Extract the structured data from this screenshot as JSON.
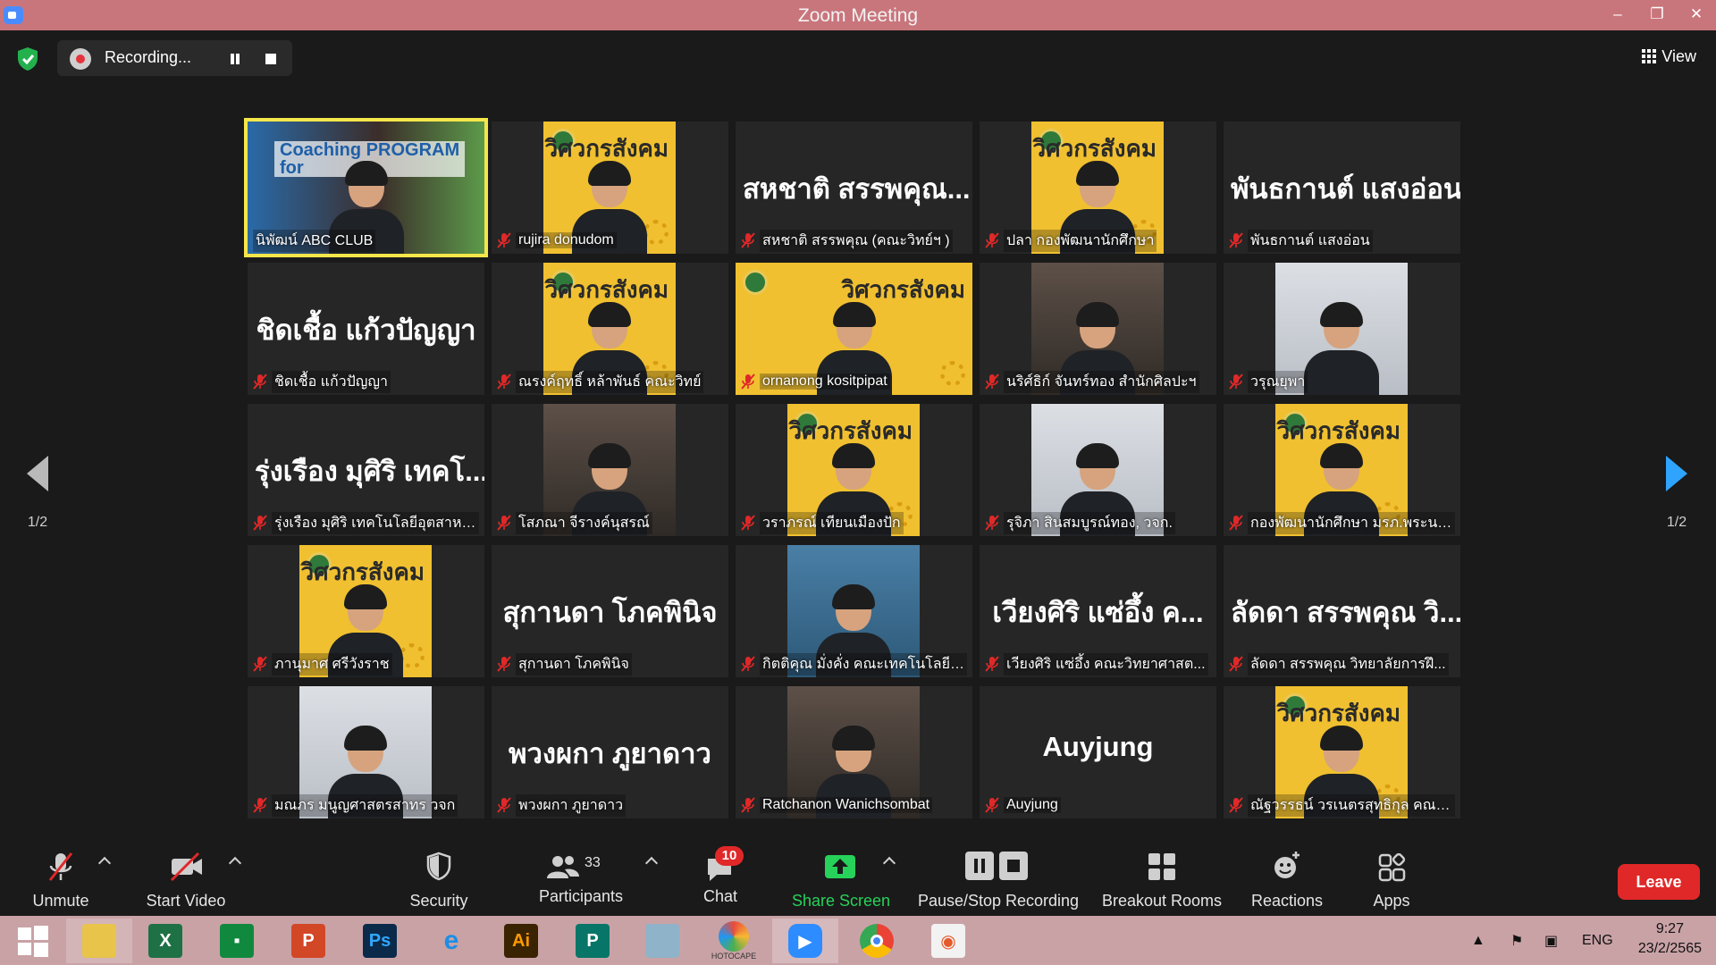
{
  "window": {
    "title": "Zoom Meeting",
    "minimize": "–",
    "restore": "❐",
    "close": "✕"
  },
  "topbar": {
    "recording_label": "Recording...",
    "view_label": "View"
  },
  "paging": {
    "left": "1/2",
    "right": "1/2"
  },
  "tiles": [
    {
      "name": "นิพัฒน์ ABC CLUB",
      "big": "",
      "video": "photo",
      "active": true
    },
    {
      "name": "rujira donudom",
      "big": "",
      "video": "poster"
    },
    {
      "name": "สหชาติ สรรพคุณ (คณะวิทย์ฯ )",
      "big": "สหชาติ สรรพคุณ...",
      "video": "none"
    },
    {
      "name": "ปลา กองพัฒนานักศึกษา",
      "big": "",
      "video": "poster"
    },
    {
      "name": "พันธกานต์ แสงอ่อน",
      "big": "พันธกานต์ แสงอ่อน",
      "video": "none"
    },
    {
      "name": "ชิดเชื้อ แก้วปัญญา",
      "big": "ชิดเชื้อ แก้วปัญญา",
      "video": "none"
    },
    {
      "name": "ณรงค์ฤทธิ์ หล้าพันธ์ คณะวิทย์",
      "big": "",
      "video": "poster"
    },
    {
      "name": "ornanong kositpipat",
      "big": "",
      "video": "poster-wide"
    },
    {
      "name": "นริศ์ธิก์ จันทร์ทอง สำนักศิลปะฯ",
      "big": "",
      "video": "photo"
    },
    {
      "name": "วรุณยุพา",
      "big": "",
      "video": "photo-light"
    },
    {
      "name": "รุ่งเรือง มุศิริ เทคโนโลยีอุตสาหกร...",
      "big": "รุ่งเรือง มุศิริ เทคโ...",
      "video": "none"
    },
    {
      "name": "โสภณา จีรางค์นุสรณ์",
      "big": "",
      "video": "photo"
    },
    {
      "name": "วราภรณ์ เทียนเมืองปัก",
      "big": "",
      "video": "poster"
    },
    {
      "name": "รุจิภา สินสมบูรณ์ทอง, วจก.",
      "big": "",
      "video": "photo-light"
    },
    {
      "name": "กองพัฒนานักศึกษา มรภ.พระนคร",
      "big": "",
      "video": "poster"
    },
    {
      "name": "ภานุมาศ ศรีวังราช",
      "big": "",
      "video": "poster"
    },
    {
      "name": "สุกานดา โภคพินิจ",
      "big": "สุกานดา โภคพินิจ",
      "video": "none"
    },
    {
      "name": "กิตติคุณ มั่งคั่ง คณะเทคโนโลยีอุ...",
      "big": "",
      "video": "photo-blue"
    },
    {
      "name": "เวียงศิริ แซ่อึ้ง คณะวิทยาศาสต...",
      "big": "เวียงศิริ แซ่อึ้ง ค...",
      "video": "none"
    },
    {
      "name": "ลัดดา สรรพคุณ วิทยาลัยการฝึ...",
      "big": "ลัดดา สรรพคุณ วิ...",
      "video": "none"
    },
    {
      "name": "มณภร มนูญศาสตรสาทร วจก",
      "big": "",
      "video": "photo-light"
    },
    {
      "name": "พวงผกา ภูยาดาว",
      "big": "พวงผกา ภูยาดาว",
      "video": "none"
    },
    {
      "name": "Ratchanon Wanichsombat",
      "big": "",
      "video": "photo"
    },
    {
      "name": "Auyjung",
      "big": "Auyjung",
      "video": "none"
    },
    {
      "name": "ณัฐวรรธน์ วรเนตรสุทธิกุล คณะเ...",
      "big": "",
      "video": "poster"
    }
  ],
  "tile_overlay": {
    "coaching_text": "Coaching PROGRAM\nfor",
    "poster_title": "วิศวกรสังคม"
  },
  "toolbar": {
    "unmute": "Unmute",
    "start_video": "Start Video",
    "security": "Security",
    "participants": "Participants",
    "participants_count": "33",
    "chat": "Chat",
    "chat_badge": "10",
    "share_screen": "Share Screen",
    "pause_stop_recording": "Pause/Stop Recording",
    "breakout_rooms": "Breakout Rooms",
    "reactions": "Reactions",
    "apps": "Apps",
    "leave": "Leave"
  },
  "taskbar": {
    "apps": [
      "start",
      "file-explorer",
      "excel",
      "store",
      "powerpoint",
      "photoshop",
      "internet-explorer",
      "illustrator",
      "publisher",
      "notes",
      "photoscape",
      "zoom",
      "chrome",
      "photos"
    ],
    "hotcape_label": "HOTOCAPE",
    "lang": "ENG",
    "time": "9:27",
    "date": "23/2/2565"
  },
  "colors": {
    "titlebar": "#c9757c",
    "taskbar": "#c9a2a6",
    "accent_green": "#27d25a",
    "leave": "#e02828",
    "active_speaker": "#f5e64a",
    "poster_bg": "#f0c030"
  }
}
